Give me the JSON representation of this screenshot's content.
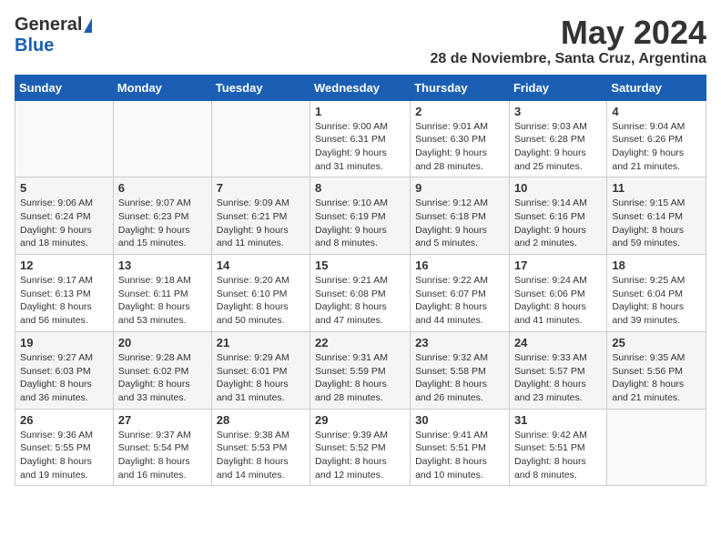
{
  "header": {
    "logo_general": "General",
    "logo_blue": "Blue",
    "month_title": "May 2024",
    "location": "28 de Noviembre, Santa Cruz, Argentina"
  },
  "days_of_week": [
    "Sunday",
    "Monday",
    "Tuesday",
    "Wednesday",
    "Thursday",
    "Friday",
    "Saturday"
  ],
  "weeks": [
    [
      {
        "day": "",
        "info": ""
      },
      {
        "day": "",
        "info": ""
      },
      {
        "day": "",
        "info": ""
      },
      {
        "day": "1",
        "info": "Sunrise: 9:00 AM\nSunset: 6:31 PM\nDaylight: 9 hours and 31 minutes."
      },
      {
        "day": "2",
        "info": "Sunrise: 9:01 AM\nSunset: 6:30 PM\nDaylight: 9 hours and 28 minutes."
      },
      {
        "day": "3",
        "info": "Sunrise: 9:03 AM\nSunset: 6:28 PM\nDaylight: 9 hours and 25 minutes."
      },
      {
        "day": "4",
        "info": "Sunrise: 9:04 AM\nSunset: 6:26 PM\nDaylight: 9 hours and 21 minutes."
      }
    ],
    [
      {
        "day": "5",
        "info": "Sunrise: 9:06 AM\nSunset: 6:24 PM\nDaylight: 9 hours and 18 minutes."
      },
      {
        "day": "6",
        "info": "Sunrise: 9:07 AM\nSunset: 6:23 PM\nDaylight: 9 hours and 15 minutes."
      },
      {
        "day": "7",
        "info": "Sunrise: 9:09 AM\nSunset: 6:21 PM\nDaylight: 9 hours and 11 minutes."
      },
      {
        "day": "8",
        "info": "Sunrise: 9:10 AM\nSunset: 6:19 PM\nDaylight: 9 hours and 8 minutes."
      },
      {
        "day": "9",
        "info": "Sunrise: 9:12 AM\nSunset: 6:18 PM\nDaylight: 9 hours and 5 minutes."
      },
      {
        "day": "10",
        "info": "Sunrise: 9:14 AM\nSunset: 6:16 PM\nDaylight: 9 hours and 2 minutes."
      },
      {
        "day": "11",
        "info": "Sunrise: 9:15 AM\nSunset: 6:14 PM\nDaylight: 8 hours and 59 minutes."
      }
    ],
    [
      {
        "day": "12",
        "info": "Sunrise: 9:17 AM\nSunset: 6:13 PM\nDaylight: 8 hours and 56 minutes."
      },
      {
        "day": "13",
        "info": "Sunrise: 9:18 AM\nSunset: 6:11 PM\nDaylight: 8 hours and 53 minutes."
      },
      {
        "day": "14",
        "info": "Sunrise: 9:20 AM\nSunset: 6:10 PM\nDaylight: 8 hours and 50 minutes."
      },
      {
        "day": "15",
        "info": "Sunrise: 9:21 AM\nSunset: 6:08 PM\nDaylight: 8 hours and 47 minutes."
      },
      {
        "day": "16",
        "info": "Sunrise: 9:22 AM\nSunset: 6:07 PM\nDaylight: 8 hours and 44 minutes."
      },
      {
        "day": "17",
        "info": "Sunrise: 9:24 AM\nSunset: 6:06 PM\nDaylight: 8 hours and 41 minutes."
      },
      {
        "day": "18",
        "info": "Sunrise: 9:25 AM\nSunset: 6:04 PM\nDaylight: 8 hours and 39 minutes."
      }
    ],
    [
      {
        "day": "19",
        "info": "Sunrise: 9:27 AM\nSunset: 6:03 PM\nDaylight: 8 hours and 36 minutes."
      },
      {
        "day": "20",
        "info": "Sunrise: 9:28 AM\nSunset: 6:02 PM\nDaylight: 8 hours and 33 minutes."
      },
      {
        "day": "21",
        "info": "Sunrise: 9:29 AM\nSunset: 6:01 PM\nDaylight: 8 hours and 31 minutes."
      },
      {
        "day": "22",
        "info": "Sunrise: 9:31 AM\nSunset: 5:59 PM\nDaylight: 8 hours and 28 minutes."
      },
      {
        "day": "23",
        "info": "Sunrise: 9:32 AM\nSunset: 5:58 PM\nDaylight: 8 hours and 26 minutes."
      },
      {
        "day": "24",
        "info": "Sunrise: 9:33 AM\nSunset: 5:57 PM\nDaylight: 8 hours and 23 minutes."
      },
      {
        "day": "25",
        "info": "Sunrise: 9:35 AM\nSunset: 5:56 PM\nDaylight: 8 hours and 21 minutes."
      }
    ],
    [
      {
        "day": "26",
        "info": "Sunrise: 9:36 AM\nSunset: 5:55 PM\nDaylight: 8 hours and 19 minutes."
      },
      {
        "day": "27",
        "info": "Sunrise: 9:37 AM\nSunset: 5:54 PM\nDaylight: 8 hours and 16 minutes."
      },
      {
        "day": "28",
        "info": "Sunrise: 9:38 AM\nSunset: 5:53 PM\nDaylight: 8 hours and 14 minutes."
      },
      {
        "day": "29",
        "info": "Sunrise: 9:39 AM\nSunset: 5:52 PM\nDaylight: 8 hours and 12 minutes."
      },
      {
        "day": "30",
        "info": "Sunrise: 9:41 AM\nSunset: 5:51 PM\nDaylight: 8 hours and 10 minutes."
      },
      {
        "day": "31",
        "info": "Sunrise: 9:42 AM\nSunset: 5:51 PM\nDaylight: 8 hours and 8 minutes."
      },
      {
        "day": "",
        "info": ""
      }
    ]
  ]
}
